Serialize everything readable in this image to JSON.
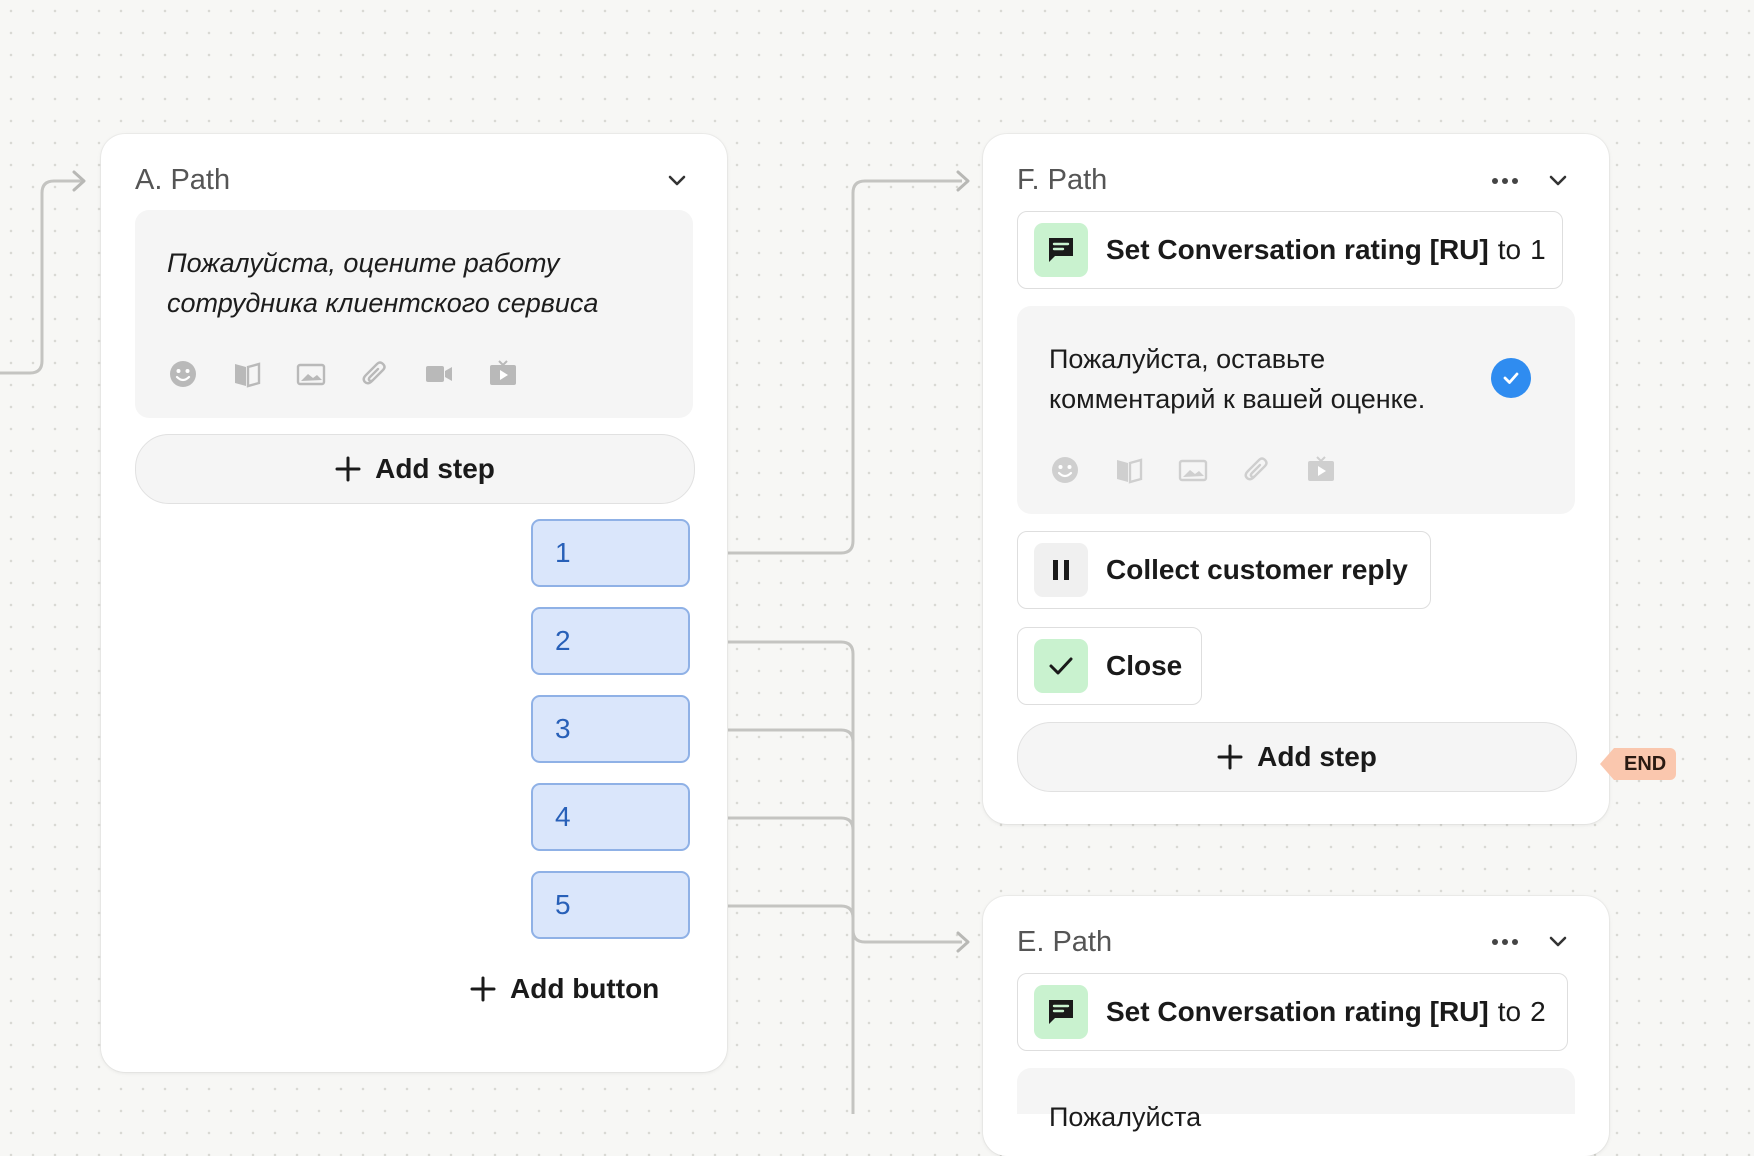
{
  "path_a": {
    "title": "A. Path",
    "message": "Пожалуйста, оцените работу сотрудника клиентского сервиса",
    "toolbar_icons": [
      "emoji-icon",
      "book-icon",
      "image-icon",
      "paperclip-icon",
      "video-icon",
      "play-icon"
    ],
    "add_step_label": "Add step",
    "buttons": [
      "1",
      "2",
      "3",
      "4",
      "5"
    ],
    "add_button_label": "Add button"
  },
  "path_f": {
    "title": "F. Path",
    "steps": {
      "set_rating": {
        "name": "Set Conversation rating [RU]",
        "connector": "to",
        "value": "1"
      },
      "collect_reply": "Collect customer reply",
      "close": "Close"
    },
    "message": "Пожалуйста, оставьте комментарий к вашей оценке.",
    "toolbar_icons": [
      "emoji-icon",
      "book-icon",
      "image-icon",
      "paperclip-icon",
      "play-icon"
    ],
    "add_step_label": "Add step",
    "end_label": "END"
  },
  "path_e": {
    "title": "E. Path",
    "steps": {
      "set_rating": {
        "name": "Set Conversation rating [RU]",
        "connector": "to",
        "value": "2"
      }
    },
    "message_partial": "Пожалуйста"
  },
  "colors": {
    "button_fill": "#dae6fb",
    "button_border": "#8fb1e6",
    "button_text": "#2860b8",
    "step_icon_green": "#c9f2cf",
    "check_blue": "#2f8cf0",
    "end_tag": "#fac7ae",
    "connector": "#c4c4c1"
  }
}
